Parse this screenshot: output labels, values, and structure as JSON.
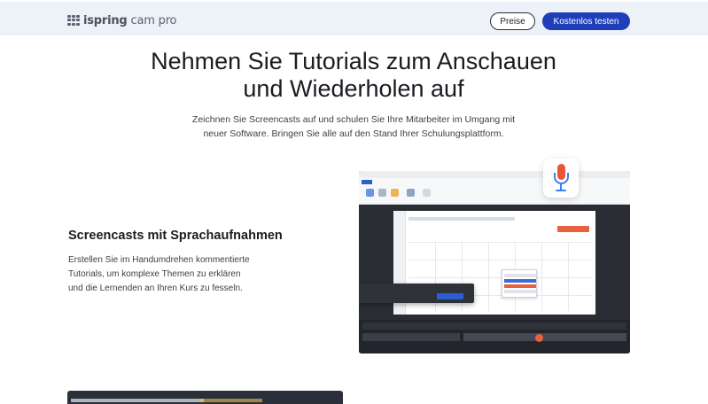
{
  "header": {
    "logo_brand": "ispring",
    "logo_product": "cam pro",
    "pricing_button": "Preise",
    "trial_button": "Kostenlos testen"
  },
  "hero": {
    "title_line1": "Nehmen Sie Tutorials zum Anschauen",
    "title_line2": "und Wiederholen auf",
    "subtitle_line1": "Zeichnen Sie Screencasts auf und schulen Sie Ihre Mitarbeiter im Umgang mit",
    "subtitle_line2": "neuer Software. Bringen Sie alle auf den Stand Ihrer Schulungsplattform."
  },
  "feature": {
    "title": "Screencasts mit Sprachaufnahmen",
    "text_line1": "Erstellen Sie im Handumdrehen kommentierte",
    "text_line2": "Tutorials, um komplexe Themen zu erklären",
    "text_line3": "und die Lernenden an Ihren Kurs zu fesseln."
  },
  "colors": {
    "accent": "#1e3fb8",
    "header_bg": "#edf1f8",
    "mic_red": "#e8553a",
    "mic_blue": "#3a7ff0"
  },
  "icons": [
    "ispring-logo-icon",
    "microphone-icon"
  ]
}
